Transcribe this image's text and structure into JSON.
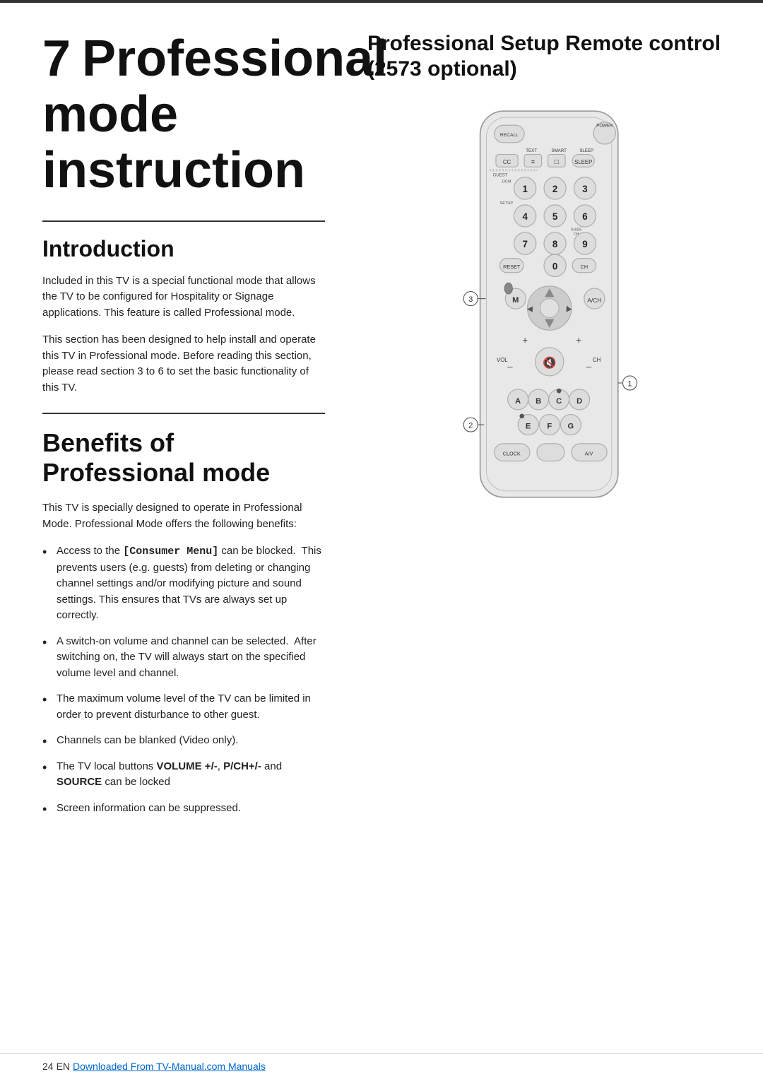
{
  "page": {
    "top_border": true,
    "chapter_number": "7",
    "chapter_title": "Professional\nmode\ninstruction",
    "left_section": {
      "intro_title": "Introduction",
      "intro_divider": true,
      "intro_paragraphs": [
        "Included in this TV is a special functional mode that allows the TV to be configured for Hospitality or Signage applications. This feature is called Professional mode.",
        "This section has been designed to help install and operate this TV in Professional mode. Before reading this section, please read section 3 to 6 to set the basic functionality of this TV."
      ],
      "benefits_divider": true,
      "benefits_title": "Benefits of Professional mode",
      "benefits_intro": "This TV is specially designed to operate in Professional Mode. Professional Mode offers the following benefits:",
      "bullet_items": [
        "Access to the [Consumer Menu] can be blocked.  This prevents users (e.g. guests) from deleting or changing channel settings and/or modifying picture and sound settings. This ensures that TVs are always set up correctly.",
        "A switch-on volume and channel can be selected.  After switching on, the TV will always start on the specified volume level and channel.",
        "The maximum volume level of the TV can be limited in order to prevent disturbance to other guest.",
        "Channels can be blanked (Video only).",
        "The TV local buttons VOLUME +/-, P/CH+/- and SOURCE can be locked",
        "Screen information can be suppressed."
      ]
    },
    "right_section": {
      "title": "Professional Setup Remote control (2573 optional)"
    },
    "remote": {
      "buttons": {
        "power": "POWER",
        "recall": "RECALL",
        "text": "TEXT",
        "smart": "SMART",
        "sleep": "SLEEP",
        "cc": "CC",
        "num1": "1",
        "num2": "2",
        "num3": "3",
        "num4": "4",
        "num5": "5",
        "num6": "6",
        "num7": "7",
        "num8": "8",
        "num9": "9",
        "num0": "0",
        "reset": "RESET",
        "guide_ch": "GUIDE CH",
        "m": "M",
        "ach": "A/CH",
        "vol_label": "VOL",
        "ch_label": "CH",
        "a": "A",
        "b": "B",
        "c": "C",
        "d": "D",
        "e": "E",
        "f": "F",
        "g": "G",
        "clock": "CLOCK",
        "av": "A/V",
        "dcm": "DCM",
        "setup": "SETUP",
        "guest": "GUEST"
      },
      "callout_1": "1",
      "callout_2": "2",
      "callout_3": "3"
    },
    "footer": {
      "page_number": "24",
      "lang": "EN",
      "link_text": "Downloaded From TV-Manual.com Manuals",
      "link_url": "#"
    }
  }
}
